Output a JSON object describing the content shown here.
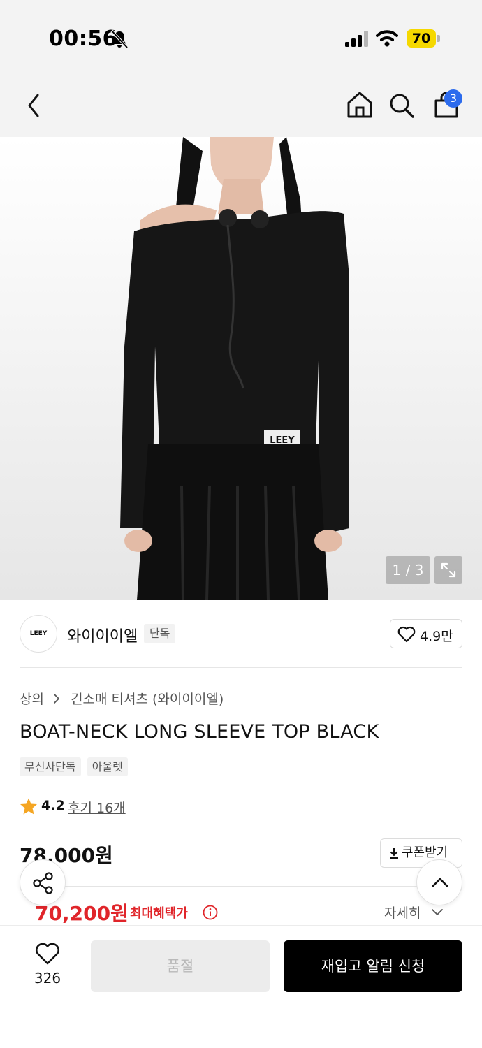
{
  "status_bar": {
    "time": "00:56",
    "battery": "70",
    "bell_icon": "bell-slash-icon",
    "signal_icon": "cellular-signal-icon",
    "wifi_icon": "wifi-icon"
  },
  "nav": {
    "back_icon": "chevron-left-icon",
    "home_icon": "home-icon",
    "search_icon": "search-icon",
    "cart_icon": "shopping-bag-icon",
    "cart_count": "3"
  },
  "gallery": {
    "counter": "1 / 3",
    "expand_icon": "expand-icon"
  },
  "brand": {
    "logo_text": "LEEY",
    "name": "와이이이엘",
    "tag": "단독",
    "likes": "4.9만"
  },
  "breadcrumb": [
    "상의",
    "긴소매 티셔츠 (와이이이엘)"
  ],
  "product": {
    "title": "BOAT-NECK LONG SLEEVE TOP BLACK",
    "tags": [
      "무신사단독",
      "아울렛"
    ],
    "rating": "4.2",
    "reviews": "후기 16개"
  },
  "price": {
    "original": "78,000원",
    "coupon_label": "쿠폰받기",
    "sale": "70,200원",
    "benefit_label": "최대혜택가",
    "detail_label": "자세히"
  },
  "bottom": {
    "wish_count": "326",
    "soldout_label": "품절",
    "restock_label": "재입고 알림 신청"
  },
  "colors": {
    "accent_red": "#e0252a",
    "badge_blue": "#2c6bed",
    "battery_yellow": "#f5d800",
    "primary_black": "#000000"
  }
}
